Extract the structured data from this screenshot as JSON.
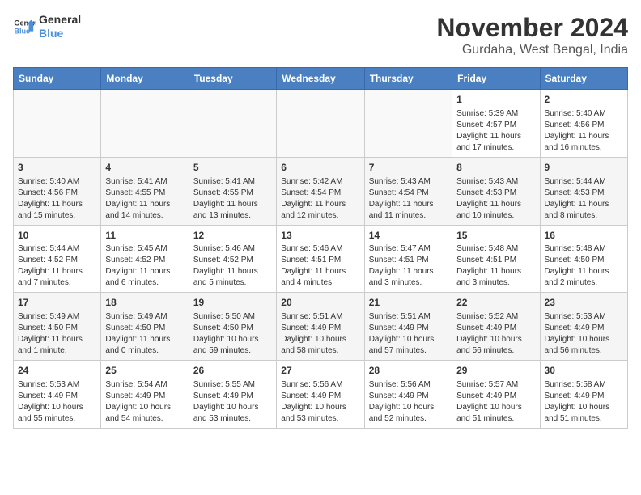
{
  "header": {
    "logo_line1": "General",
    "logo_line2": "Blue",
    "month": "November 2024",
    "location": "Gurdaha, West Bengal, India"
  },
  "columns": [
    "Sunday",
    "Monday",
    "Tuesday",
    "Wednesday",
    "Thursday",
    "Friday",
    "Saturday"
  ],
  "weeks": [
    [
      {
        "day": "",
        "text": ""
      },
      {
        "day": "",
        "text": ""
      },
      {
        "day": "",
        "text": ""
      },
      {
        "day": "",
        "text": ""
      },
      {
        "day": "",
        "text": ""
      },
      {
        "day": "1",
        "text": "Sunrise: 5:39 AM\nSunset: 4:57 PM\nDaylight: 11 hours and 17 minutes."
      },
      {
        "day": "2",
        "text": "Sunrise: 5:40 AM\nSunset: 4:56 PM\nDaylight: 11 hours and 16 minutes."
      }
    ],
    [
      {
        "day": "3",
        "text": "Sunrise: 5:40 AM\nSunset: 4:56 PM\nDaylight: 11 hours and 15 minutes."
      },
      {
        "day": "4",
        "text": "Sunrise: 5:41 AM\nSunset: 4:55 PM\nDaylight: 11 hours and 14 minutes."
      },
      {
        "day": "5",
        "text": "Sunrise: 5:41 AM\nSunset: 4:55 PM\nDaylight: 11 hours and 13 minutes."
      },
      {
        "day": "6",
        "text": "Sunrise: 5:42 AM\nSunset: 4:54 PM\nDaylight: 11 hours and 12 minutes."
      },
      {
        "day": "7",
        "text": "Sunrise: 5:43 AM\nSunset: 4:54 PM\nDaylight: 11 hours and 11 minutes."
      },
      {
        "day": "8",
        "text": "Sunrise: 5:43 AM\nSunset: 4:53 PM\nDaylight: 11 hours and 10 minutes."
      },
      {
        "day": "9",
        "text": "Sunrise: 5:44 AM\nSunset: 4:53 PM\nDaylight: 11 hours and 8 minutes."
      }
    ],
    [
      {
        "day": "10",
        "text": "Sunrise: 5:44 AM\nSunset: 4:52 PM\nDaylight: 11 hours and 7 minutes."
      },
      {
        "day": "11",
        "text": "Sunrise: 5:45 AM\nSunset: 4:52 PM\nDaylight: 11 hours and 6 minutes."
      },
      {
        "day": "12",
        "text": "Sunrise: 5:46 AM\nSunset: 4:52 PM\nDaylight: 11 hours and 5 minutes."
      },
      {
        "day": "13",
        "text": "Sunrise: 5:46 AM\nSunset: 4:51 PM\nDaylight: 11 hours and 4 minutes."
      },
      {
        "day": "14",
        "text": "Sunrise: 5:47 AM\nSunset: 4:51 PM\nDaylight: 11 hours and 3 minutes."
      },
      {
        "day": "15",
        "text": "Sunrise: 5:48 AM\nSunset: 4:51 PM\nDaylight: 11 hours and 3 minutes."
      },
      {
        "day": "16",
        "text": "Sunrise: 5:48 AM\nSunset: 4:50 PM\nDaylight: 11 hours and 2 minutes."
      }
    ],
    [
      {
        "day": "17",
        "text": "Sunrise: 5:49 AM\nSunset: 4:50 PM\nDaylight: 11 hours and 1 minute."
      },
      {
        "day": "18",
        "text": "Sunrise: 5:49 AM\nSunset: 4:50 PM\nDaylight: 11 hours and 0 minutes."
      },
      {
        "day": "19",
        "text": "Sunrise: 5:50 AM\nSunset: 4:50 PM\nDaylight: 10 hours and 59 minutes."
      },
      {
        "day": "20",
        "text": "Sunrise: 5:51 AM\nSunset: 4:49 PM\nDaylight: 10 hours and 58 minutes."
      },
      {
        "day": "21",
        "text": "Sunrise: 5:51 AM\nSunset: 4:49 PM\nDaylight: 10 hours and 57 minutes."
      },
      {
        "day": "22",
        "text": "Sunrise: 5:52 AM\nSunset: 4:49 PM\nDaylight: 10 hours and 56 minutes."
      },
      {
        "day": "23",
        "text": "Sunrise: 5:53 AM\nSunset: 4:49 PM\nDaylight: 10 hours and 56 minutes."
      }
    ],
    [
      {
        "day": "24",
        "text": "Sunrise: 5:53 AM\nSunset: 4:49 PM\nDaylight: 10 hours and 55 minutes."
      },
      {
        "day": "25",
        "text": "Sunrise: 5:54 AM\nSunset: 4:49 PM\nDaylight: 10 hours and 54 minutes."
      },
      {
        "day": "26",
        "text": "Sunrise: 5:55 AM\nSunset: 4:49 PM\nDaylight: 10 hours and 53 minutes."
      },
      {
        "day": "27",
        "text": "Sunrise: 5:56 AM\nSunset: 4:49 PM\nDaylight: 10 hours and 53 minutes."
      },
      {
        "day": "28",
        "text": "Sunrise: 5:56 AM\nSunset: 4:49 PM\nDaylight: 10 hours and 52 minutes."
      },
      {
        "day": "29",
        "text": "Sunrise: 5:57 AM\nSunset: 4:49 PM\nDaylight: 10 hours and 51 minutes."
      },
      {
        "day": "30",
        "text": "Sunrise: 5:58 AM\nSunset: 4:49 PM\nDaylight: 10 hours and 51 minutes."
      }
    ]
  ]
}
